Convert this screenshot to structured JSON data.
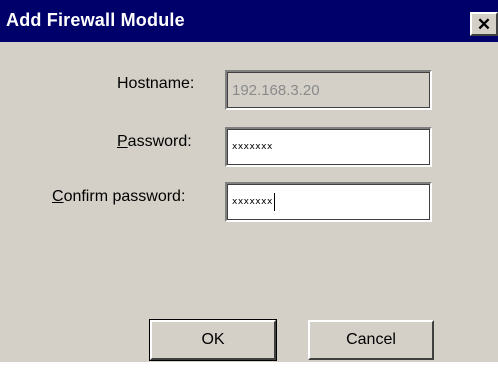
{
  "window": {
    "title": "Add Firewall Module",
    "close_glyph": "✕"
  },
  "form": {
    "hostname": {
      "label": "Hostname:",
      "value": "192.168.3.20",
      "enabled": false
    },
    "password": {
      "label_accel": "P",
      "label_rest": "assword:",
      "value": "xxxxxxx"
    },
    "confirm_password": {
      "label_accel": "C",
      "label_rest": "onfirm password:",
      "value": "xxxxxxx",
      "focused": true
    }
  },
  "buttons": {
    "ok": "OK",
    "cancel": "Cancel"
  },
  "colors": {
    "titlebar": "#00006a",
    "dialog_face": "#d4d0c8"
  }
}
